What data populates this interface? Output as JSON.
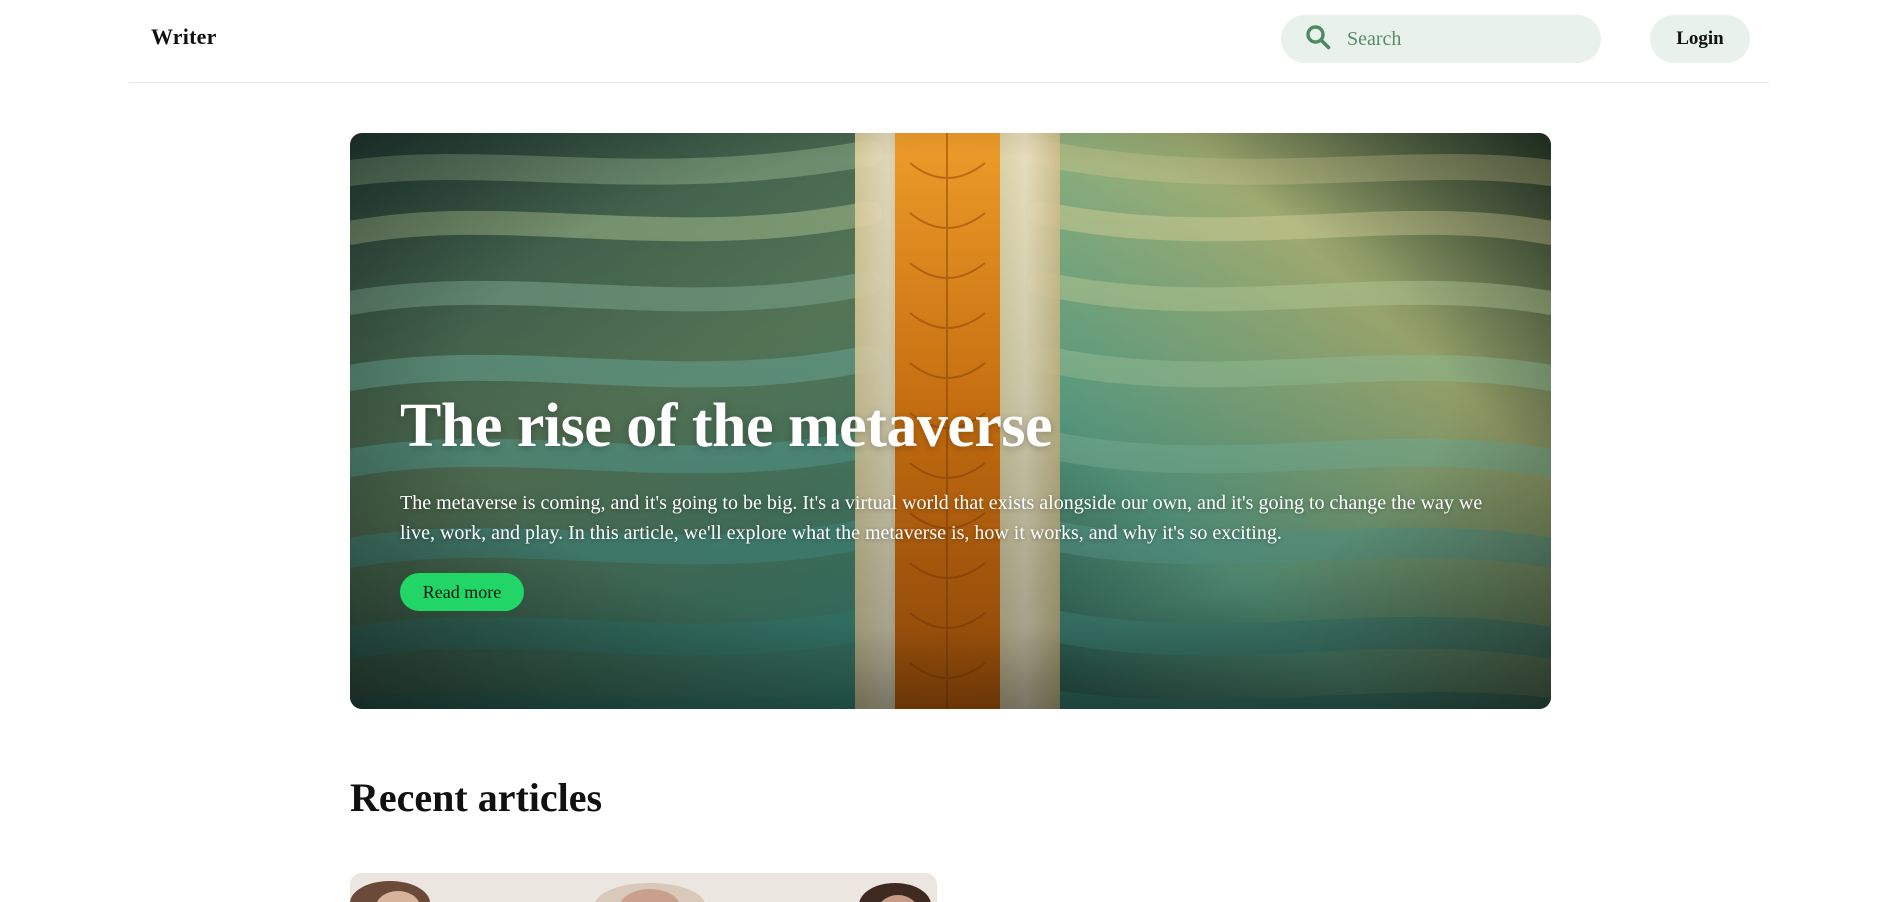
{
  "header": {
    "brand": "Writer",
    "search": {
      "placeholder": "Search",
      "icon": "search-icon"
    },
    "login_label": "Login"
  },
  "hero": {
    "title": "The rise of the metaverse",
    "description": "The metaverse is coming, and it's going to be big. It's a virtual world that exists alongside our own, and it's going to change the way we live, work, and play. In this article, we'll explore what the metaverse is, how it works, and why it's so exciting.",
    "cta_label": "Read more",
    "image": "abstract-leaf-layers-image"
  },
  "recent": {
    "title": "Recent articles",
    "cards": [
      {
        "image": "people-photo-thumbnail"
      }
    ]
  },
  "colors": {
    "accent": "#22d567",
    "soft_green": "#e8f1eb",
    "search_icon": "#4d8a64"
  }
}
